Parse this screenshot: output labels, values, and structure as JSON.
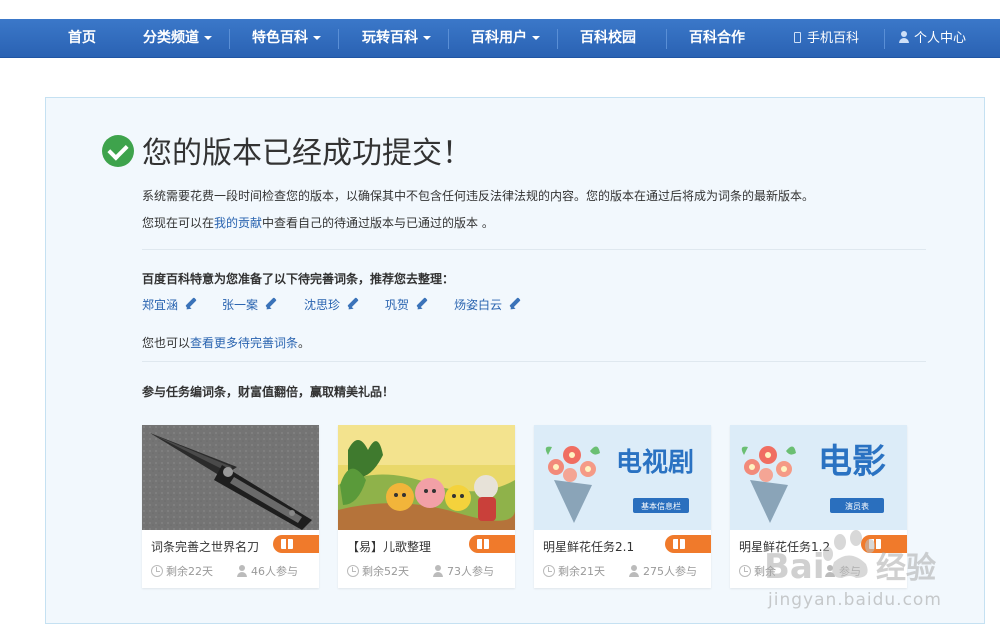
{
  "nav": {
    "items": [
      {
        "label": "首页"
      },
      {
        "label": "分类频道"
      },
      {
        "label": "特色百科"
      },
      {
        "label": "玩转百科"
      },
      {
        "label": "百科用户"
      },
      {
        "label": "百科校园"
      },
      {
        "label": "百科合作"
      }
    ],
    "mobile": "手机百科",
    "account": "个人中心"
  },
  "header": {
    "title": "您的版本已经成功提交！"
  },
  "notice": {
    "line1": "系统需要花费一段时间检查您的版本，以确保其中不包含任何违反法律法规的内容。您的版本在通过后将成为词条的最新版本。",
    "line2_prefix": "您现在可以在",
    "line2_link": "我的贡献",
    "line2_suffix": "中查看自己的待通过版本与已通过的版本 。"
  },
  "suggest": {
    "heading": "百度百科特意为您准备了以下待完善词条，推荐您去整理：",
    "entries": [
      "郑宜涵",
      "张一案",
      "沈思珍",
      "巩贺",
      "炀姿白云"
    ],
    "more_prefix": "您也可以",
    "more_link": "查看更多待完善词条",
    "more_suffix": "。"
  },
  "tasks": {
    "heading": "参与任务编词条，财富值翻倍，赢取精美礼品！",
    "cards": [
      {
        "title": "词条完善之世界名刀",
        "remaining": "剩余22天",
        "participants": "46人参与"
      },
      {
        "title": "【易】儿歌整理",
        "remaining": "剩余52天",
        "participants": "73人参与"
      },
      {
        "title": "明星鲜花任务2.1",
        "remaining": "剩余21天",
        "participants": "275人参与",
        "banner": "电视剧",
        "badge": "基本信息栏"
      },
      {
        "title": "明星鲜花任务1.2",
        "remaining": "剩余",
        "participants": "参与",
        "banner": "电影",
        "badge": "演员表"
      }
    ]
  },
  "watermark": {
    "brand": "Bai",
    "cn": "经验",
    "site": "jingyan.baidu.com"
  },
  "colors": {
    "nav_bg": "#2a62b3",
    "panel_bg": "#f2f8fd",
    "link": "#2a64b0",
    "success": "#3ea34c",
    "tag": "#f07a2b"
  }
}
